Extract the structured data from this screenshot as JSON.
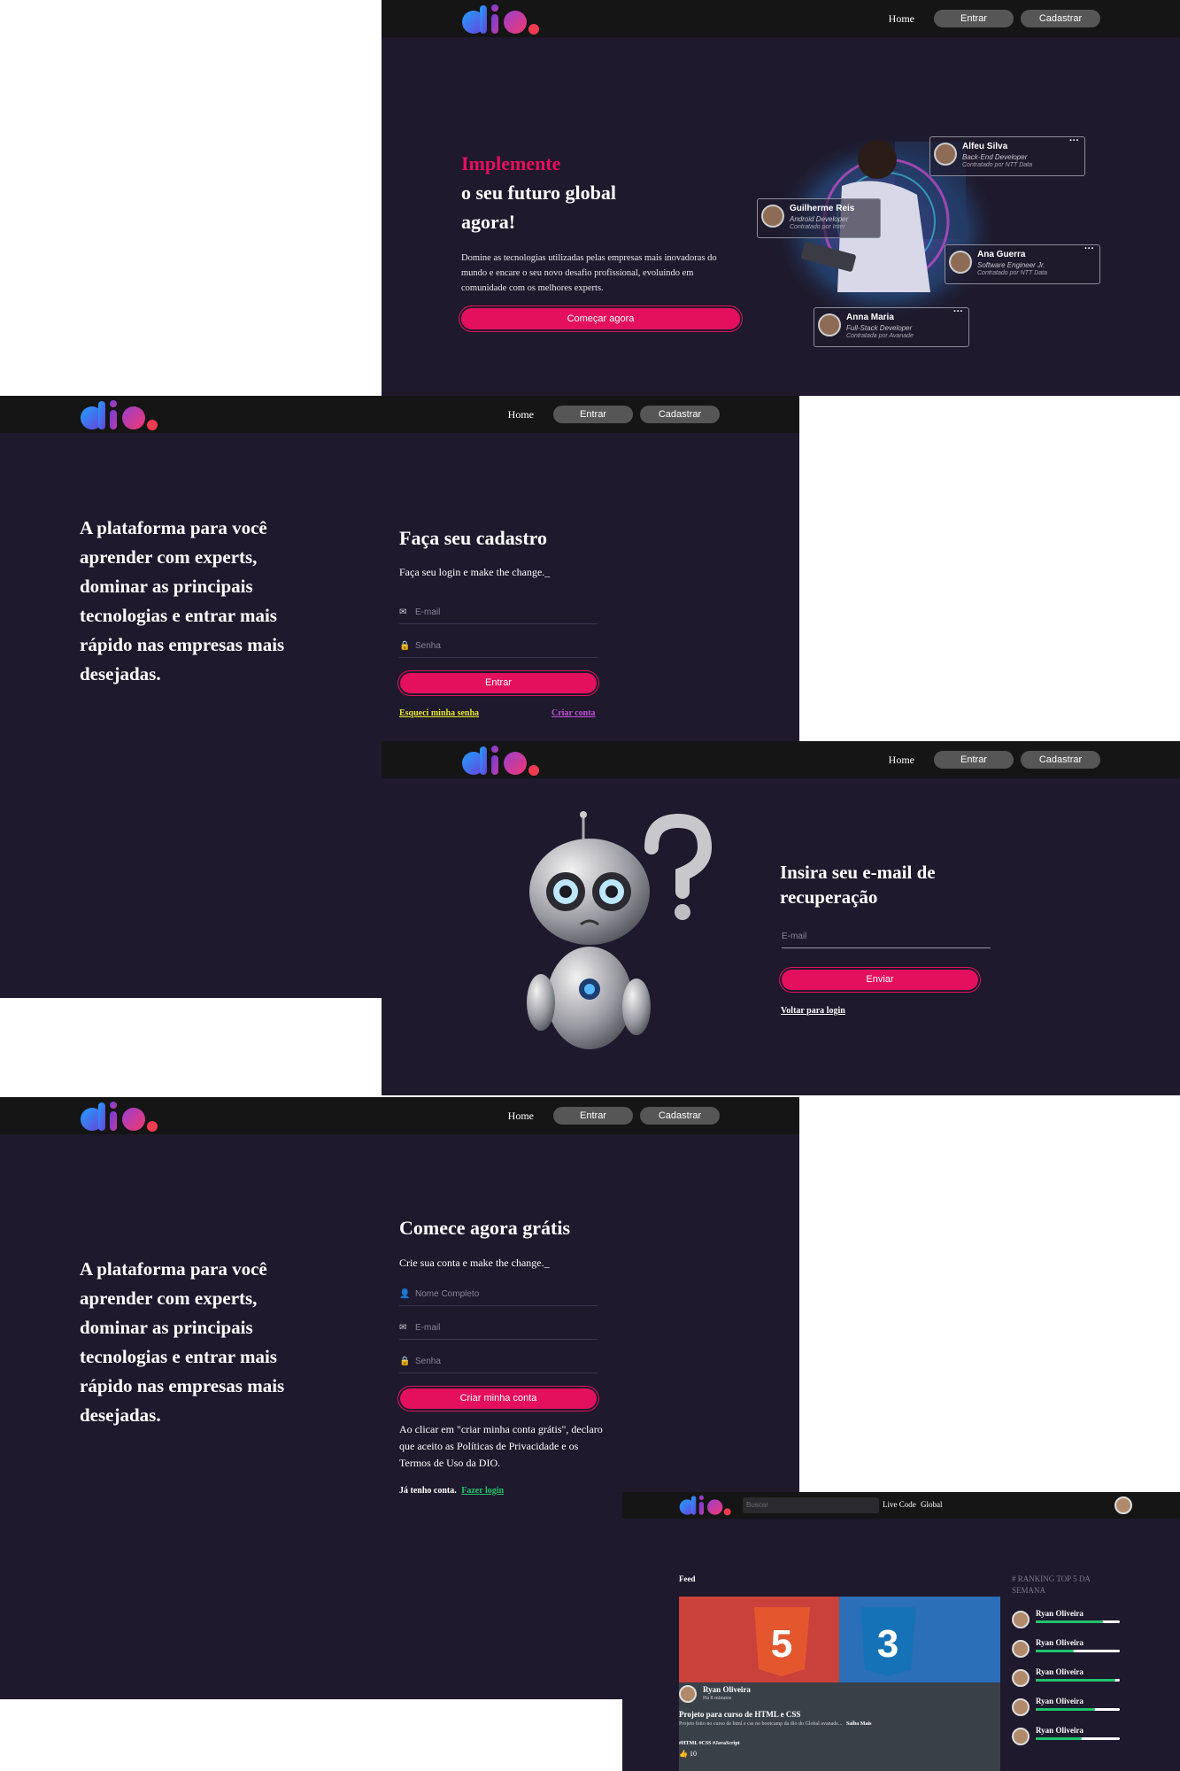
{
  "nav": {
    "home": "Home",
    "login": "Entrar",
    "signup": "Cadastrar"
  },
  "landing": {
    "title_highlight": "Implemente",
    "title_line2": "o seu futuro global",
    "title_line3": "agora!",
    "description": "Domine as tecnologias utilizadas pelas empresas mais inovadoras do mundo e encare o seu novo desafio profissional, evoluindo em comunidade com os melhores experts.",
    "cta": "Começar agora",
    "cards": [
      {
        "name": "Alfeu Silva",
        "role": "Back-End Developer",
        "company": "Contratado por NTT Data"
      },
      {
        "name": "Guilherme Reis",
        "role": "Android Developer",
        "company": "Contratado por Inter"
      },
      {
        "name": "Ana Guerra",
        "role": "Software Engineer Jr.",
        "company": "Contratado por NTT Data"
      },
      {
        "name": "Anna Maria",
        "role": "Full-Stack Developer",
        "company": "Contratada por Avanade"
      }
    ]
  },
  "login": {
    "tagline": "A plataforma para você aprender com experts, dominar as principais tecnologias e entrar mais rápido nas empresas mais desejadas.",
    "title": "Faça seu cadastro",
    "subtitle": "Faça seu login e make the change._",
    "email_placeholder": "E-mail",
    "password_placeholder": "Senha",
    "submit": "Entrar",
    "forgot": "Esqueci minha senha",
    "create": "Criar conta"
  },
  "recovery": {
    "title_line1": "Insira seu e-mail de",
    "title_line2": "recuperação",
    "email_placeholder": "E-mail",
    "submit": "Enviar",
    "back": "Voltar para login"
  },
  "signup": {
    "tagline": "A plataforma para você aprender com experts, dominar as principais tecnologias e entrar mais rápido nas empresas mais desejadas.",
    "title": "Comece agora grátis",
    "subtitle": "Crie sua conta e make the change._",
    "name_placeholder": "Nome Completo",
    "email_placeholder": "E-mail",
    "password_placeholder": "Senha",
    "submit": "Criar minha conta",
    "terms": "Ao clicar em \"criar minha conta grátis\", declaro que aceito as Políticas de Privacidade e os Termos de Uso da DIO.",
    "have_account": "Já tenho conta.",
    "login_link": "Fazer login"
  },
  "feed": {
    "search_placeholder": "Buscar",
    "menu": [
      "Live Code",
      "Global"
    ],
    "title": "Feed",
    "post": {
      "author": "Ryan Oliveira",
      "time": "Há 8 minutos",
      "title": "Projeto para curso de HTML e CSS",
      "body": "Projeto feito no curso de html e css no bootcamp da dio do Global avanade...",
      "more": "Saiba Mais",
      "tags": "#HTML #CSS #JavaScript",
      "likes": "10"
    },
    "ranking_title": "# RANKING TOP 5 DA SEMANA",
    "ranking": [
      {
        "name": "Ryan Oliveira",
        "progress": 0.8
      },
      {
        "name": "Ryan Oliveira",
        "progress": 0.45
      },
      {
        "name": "Ryan Oliveira",
        "progress": 0.95
      },
      {
        "name": "Ryan Oliveira",
        "progress": 0.7
      },
      {
        "name": "Ryan Oliveira",
        "progress": 0.55
      }
    ]
  },
  "colors": {
    "bg": "#1e192c",
    "header": "#151515",
    "accent": "#e4105d",
    "success": "#1fc36c"
  },
  "icons": [
    "dio-logo",
    "envelope-icon",
    "lock-icon",
    "user-icon",
    "robot-illustration",
    "html5-icon",
    "css3-icon",
    "like-icon",
    "avatar"
  ]
}
